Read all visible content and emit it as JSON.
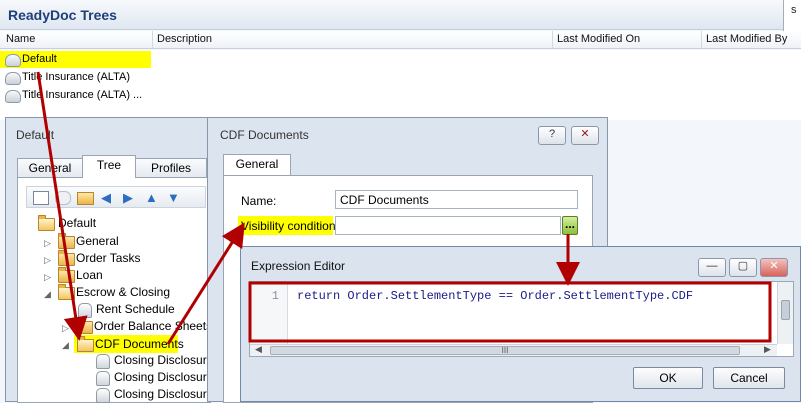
{
  "main": {
    "title": "ReadyDoc Trees",
    "side_char": "s",
    "columns": [
      "Name",
      "Description",
      "Last Modified On",
      "Last Modified By"
    ],
    "rows": [
      "Default",
      "Title Insurance (ALTA)",
      "Title Insurance (ALTA) ..."
    ]
  },
  "default_dialog": {
    "title": "Default",
    "tabs": [
      "General",
      "Tree",
      "Profiles"
    ],
    "tree": [
      {
        "label": "Default"
      },
      {
        "label": "General"
      },
      {
        "label": "Order Tasks"
      },
      {
        "label": "Loan"
      },
      {
        "label": "Escrow & Closing"
      },
      {
        "label": "Rent Schedule"
      },
      {
        "label": "Order Balance Sheets"
      },
      {
        "label": "CDF Documents"
      },
      {
        "label": "Closing Disclosure F"
      },
      {
        "label": "Closing Disclosure F"
      },
      {
        "label": "Closing Disclosure F"
      }
    ]
  },
  "cdf_dialog": {
    "title": "CDF Documents",
    "help_label": "?",
    "close_label": "✕",
    "tab": "General",
    "name_label": "Name:",
    "name_value": "CDF Documents",
    "visibility_label": "Visibility condition:",
    "visibility_value": "",
    "ellipsis_label": "..."
  },
  "expression_editor": {
    "title": "Expression Editor",
    "line_number": "1",
    "code": "return Order.SettlementType == Order.SettlementType.CDF",
    "ok_label": "OK",
    "cancel_label": "Cancel",
    "scroll_grip": "III"
  },
  "colors": {
    "highlight": "#ffff00",
    "annotation": "#b00000"
  }
}
